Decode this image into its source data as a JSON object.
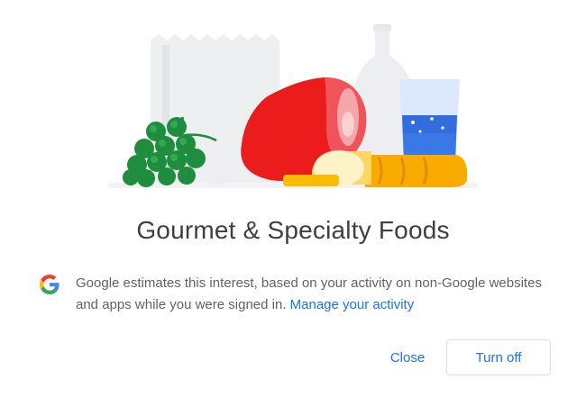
{
  "dialog": {
    "title": "Gourmet & Specialty Foods",
    "info_text": "Google estimates this interest, based on your activity on non-Google websites and apps while you were signed in.",
    "manage_link": "Manage your activity",
    "close_label": "Close",
    "turn_off_label": "Turn off"
  },
  "illustration": {
    "subject": "groceries: receipt, grapes, ham, bottle, glass of water, cheese, bread"
  },
  "colors": {
    "accent": "#1a73e8",
    "title": "#3c4043",
    "text": "#5f6368",
    "button_border": "#dadce0"
  },
  "icons": [
    "google-logo-icon"
  ]
}
